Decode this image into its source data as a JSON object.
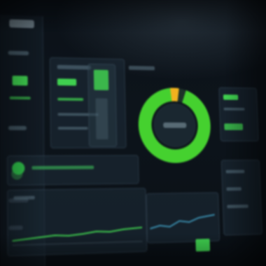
{
  "app": {
    "title": "",
    "accent_color": "#3fcf4f",
    "warning_color": "#f2b21e",
    "background_color": "#0d141b"
  },
  "sidebar": {
    "icons": [
      "dashboard-icon",
      "chart-icon",
      "settings-icon"
    ]
  },
  "donut": {
    "center_label": "",
    "ring_fraction_green": 0.96,
    "ring_fraction_orange": 0.04
  }
}
